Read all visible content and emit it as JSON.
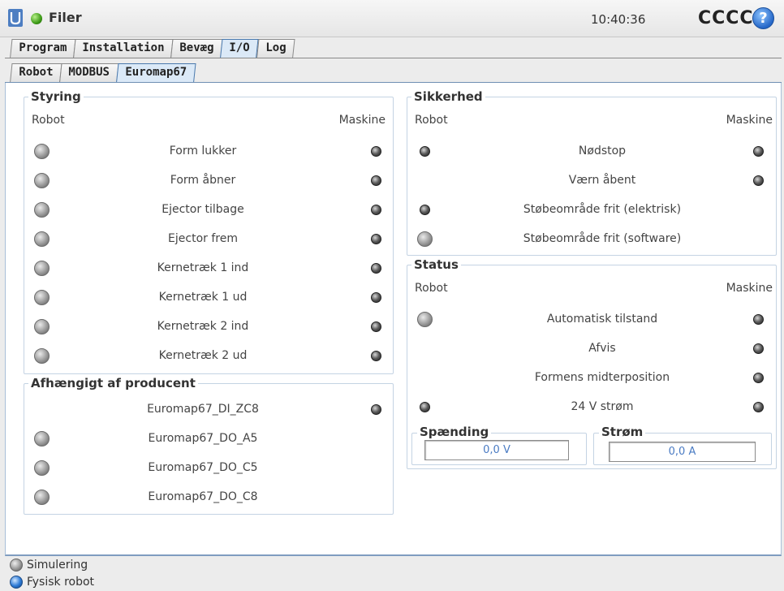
{
  "header": {
    "app_title": "Filer",
    "clock": "10:40:36",
    "robot_name": "CCCC",
    "help_icon": "question-mark-icon"
  },
  "main_tabs": [
    "Program",
    "Installation",
    "Bevæg",
    "I/O",
    "Log"
  ],
  "active_main_tab": "I/O",
  "sub_tabs": [
    "Robot",
    "MODBUS",
    "Euromap67"
  ],
  "active_sub_tab": "Euromap67",
  "styring": {
    "title": "Styring",
    "robot_header": "Robot",
    "machine_header": "Maskine",
    "rows": [
      "Form lukker",
      "Form åbner",
      "Ejector tilbage",
      "Ejector frem",
      "Kernetræk 1 ind",
      "Kernetræk 1 ud",
      "Kernetræk 2 ind",
      "Kernetræk 2 ud"
    ]
  },
  "afhaengigt": {
    "title": "Afhængigt af producent",
    "rows": [
      "Euromap67_DI_ZC8",
      "Euromap67_DO_A5",
      "Euromap67_DO_C5",
      "Euromap67_DO_C8"
    ]
  },
  "sikkerhed": {
    "title": "Sikkerhed",
    "robot_header": "Robot",
    "machine_header": "Maskine",
    "rows": [
      "Nødstop",
      "Værn åbent",
      "Støbeområde frit (elektrisk)",
      "Støbeområde frit (software)"
    ]
  },
  "status": {
    "title": "Status",
    "robot_header": "Robot",
    "machine_header": "Maskine",
    "rows": [
      "Automatisk tilstand",
      "Afvis",
      "Formens midterposition",
      "24 V strøm"
    ],
    "spaending_title": "Spænding",
    "spaending_value": "0,0 V",
    "strom_title": "Strøm",
    "strom_value": "0,0 A"
  },
  "footer": {
    "simulation_label": "Simulering",
    "physical_label": "Fysisk robot"
  }
}
